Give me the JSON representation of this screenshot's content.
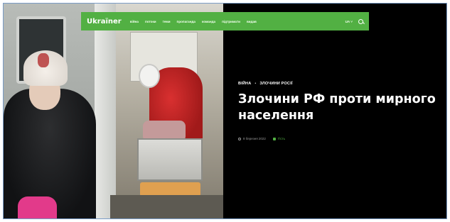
{
  "navbar": {
    "logo": "Ukraїner",
    "items": [
      "війна",
      "потоки",
      "теми",
      "пропаганда",
      "команда",
      "підтримати",
      "видав"
    ],
    "lang": "UA ˅"
  },
  "article": {
    "breadcrumb": [
      "ВІЙНА",
      "ЗЛОЧИНИ РОСІЇ"
    ],
    "breadcrumb_separator": "•",
    "title": "Злочини РФ проти мирного населення",
    "date": "8 березня 2022",
    "tag": "Гість"
  },
  "colors": {
    "accent": "#52b043",
    "background": "#000000",
    "text": "#ffffff"
  }
}
